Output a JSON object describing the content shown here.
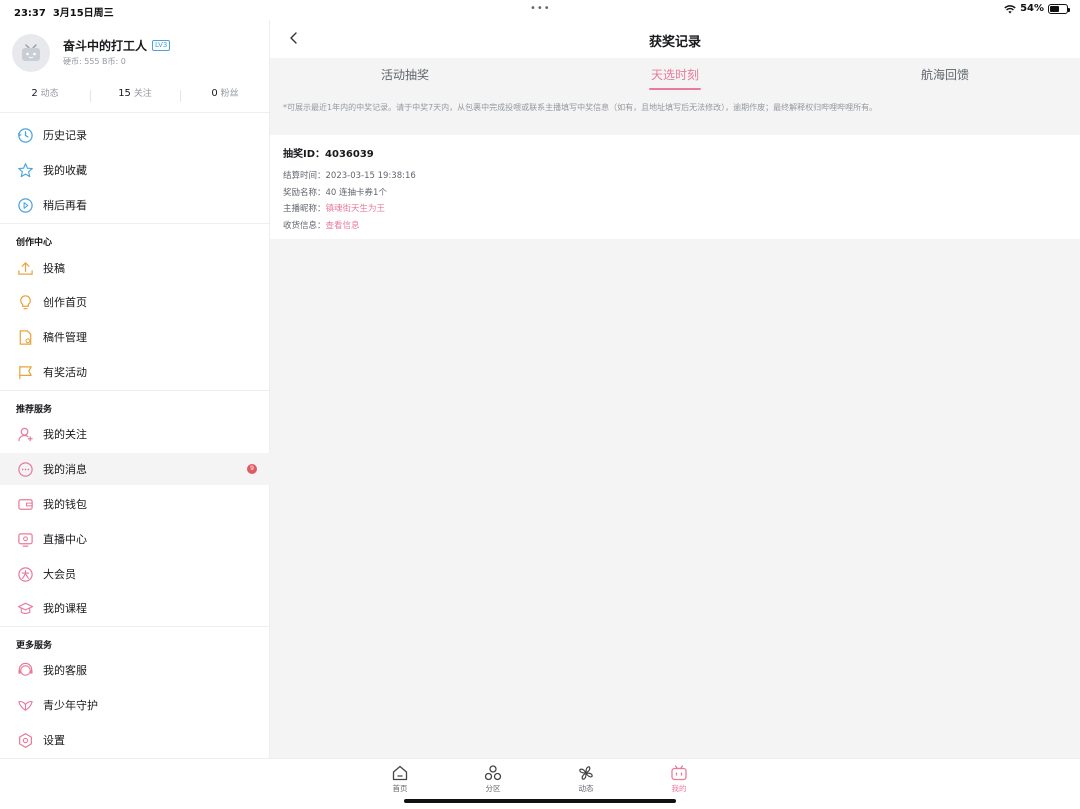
{
  "status_bar": {
    "time": "23:37",
    "date": "3月15日周三",
    "dots": "•••",
    "battery": "54%",
    "battery_level": 0.54
  },
  "profile": {
    "name": "奋斗中的打工人",
    "level": "LV3",
    "coins": "硬币: 555  B币: 0"
  },
  "stats": [
    {
      "count": "2",
      "label": "动态"
    },
    {
      "count": "15",
      "label": "关注"
    },
    {
      "count": "0",
      "label": "粉丝"
    }
  ],
  "menu_group1": [
    {
      "label": "历史记录",
      "icon": "history-icon"
    },
    {
      "label": "我的收藏",
      "icon": "star-icon"
    },
    {
      "label": "稍后再看",
      "icon": "play-later-icon"
    }
  ],
  "sections": {
    "creation": "创作中心",
    "recommend": "推荐服务",
    "more": "更多服务"
  },
  "menu_creation": [
    {
      "label": "投稿",
      "icon": "upload-icon"
    },
    {
      "label": "创作首页",
      "icon": "bulb-icon"
    },
    {
      "label": "稿件管理",
      "icon": "document-icon"
    },
    {
      "label": "有奖活动",
      "icon": "flag-icon"
    }
  ],
  "menu_recommend": [
    {
      "label": "我的关注",
      "icon": "user-follow-icon"
    },
    {
      "label": "我的消息",
      "icon": "message-icon",
      "badge": "9"
    },
    {
      "label": "我的钱包",
      "icon": "wallet-icon"
    },
    {
      "label": "直播中心",
      "icon": "live-icon"
    },
    {
      "label": "大会员",
      "icon": "vip-icon"
    },
    {
      "label": "我的课程",
      "icon": "course-icon"
    }
  ],
  "menu_more": [
    {
      "label": "我的客服",
      "icon": "headset-icon"
    },
    {
      "label": "青少年守护",
      "icon": "youth-icon"
    },
    {
      "label": "设置",
      "icon": "settings-icon"
    }
  ],
  "main": {
    "title": "获奖记录",
    "tabs": [
      "活动抽奖",
      "天选时刻",
      "航海回馈"
    ],
    "active_tab": "天选时刻",
    "notice": "*可展示最近1年内的中奖记录。请于中奖7天内，从包裹中完成投喂或联系主播填写中奖信息（如有，且地址填写后无法修改），逾期作废；最终解释权归哔哩哔哩所有。",
    "record": {
      "id_label": "抽奖ID：",
      "id_value": "4036039",
      "time_label": "结算时间：",
      "time_value": "2023-03-15 19:38:16",
      "prize_label": "奖励名称：",
      "prize_value": "40 连抽卡券1个",
      "streamer_label": "主播昵称：",
      "streamer_value": "镇魂街天生为王",
      "shipping_label": "收货信息：",
      "shipping_value": "查看信息"
    }
  },
  "tabbar": [
    {
      "label": "首页",
      "icon": "home-icon"
    },
    {
      "label": "分区",
      "icon": "category-icon"
    },
    {
      "label": "动态",
      "icon": "dynamic-icon"
    },
    {
      "label": "我的",
      "icon": "mine-icon",
      "active": true
    }
  ],
  "colors": {
    "accent": "#e87b9b",
    "text": "#18191c",
    "muted": "#9499a0",
    "badge": "#e15b64"
  }
}
